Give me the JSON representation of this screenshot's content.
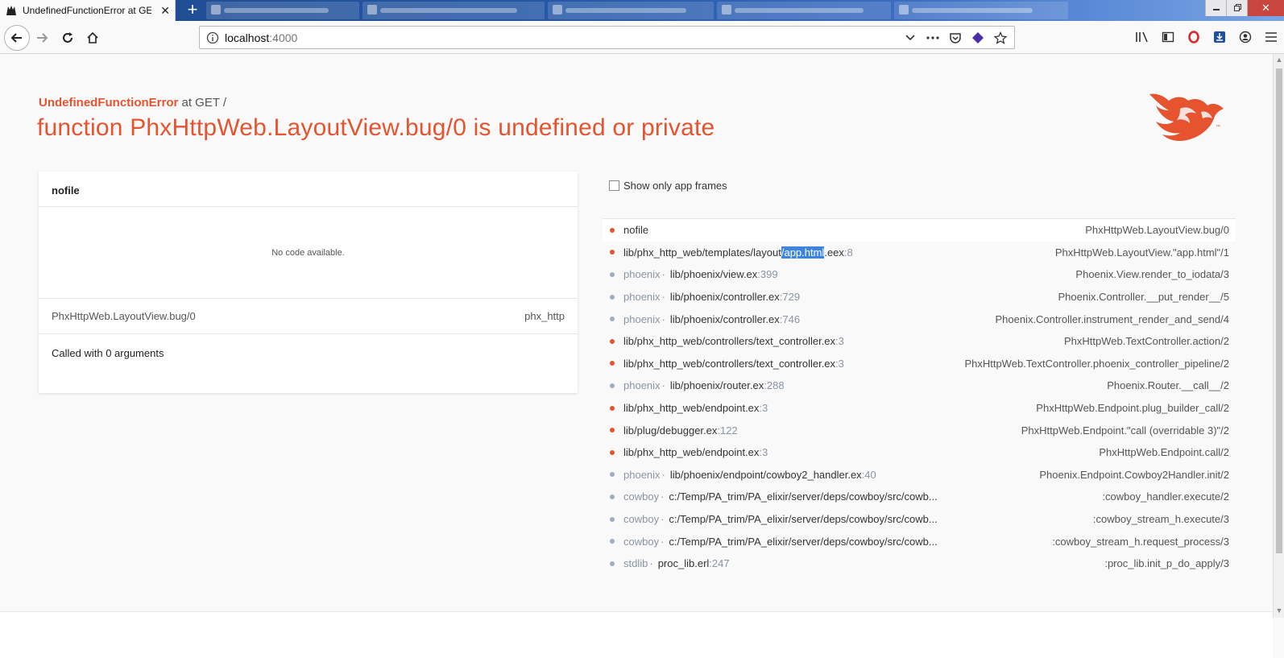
{
  "browser": {
    "tab_title": "UndefinedFunctionError at GET /",
    "url_host": "localhost",
    "url_port": ":4000",
    "new_tab_label": "+",
    "close_tab_label": "✕",
    "window_close_label": "✕"
  },
  "error": {
    "name": "UndefinedFunctionError",
    "at_text": " at GET /",
    "message": "function PhxHttpWeb.LayoutView.bug/0 is undefined or private"
  },
  "code_card": {
    "file": "nofile",
    "no_code_text": "No code available.",
    "function": "PhxHttpWeb.LayoutView.bug/0",
    "app": "phx_http",
    "args_text": "Called with 0 arguments"
  },
  "frames_panel": {
    "toggle_label": "Show only app frames",
    "frames": [
      {
        "app": "",
        "file": "nofile",
        "line": "",
        "info": "PhxHttpWeb.LayoutView.bug/0",
        "kind": "app",
        "active": true
      },
      {
        "app": "",
        "file_pre": "lib/phx_http_web/templates/layout",
        "file_hl": "/app.html",
        "file_post": ".eex",
        "line": ":8",
        "info": "PhxHttpWeb.LayoutView.\"app.html\"/1",
        "kind": "app"
      },
      {
        "app": "phoenix",
        "file": "lib/phoenix/view.ex",
        "line": ":399",
        "info": "Phoenix.View.render_to_iodata/3",
        "kind": "lib"
      },
      {
        "app": "phoenix",
        "file": "lib/phoenix/controller.ex",
        "line": ":729",
        "info": "Phoenix.Controller.__put_render__/5",
        "kind": "lib"
      },
      {
        "app": "phoenix",
        "file": "lib/phoenix/controller.ex",
        "line": ":746",
        "info": "Phoenix.Controller.instrument_render_and_send/4",
        "kind": "lib"
      },
      {
        "app": "",
        "file": "lib/phx_http_web/controllers/text_controller.ex",
        "line": ":3",
        "info": "PhxHttpWeb.TextController.action/2",
        "kind": "app"
      },
      {
        "app": "",
        "file": "lib/phx_http_web/controllers/text_controller.ex",
        "line": ":3",
        "info": "PhxHttpWeb.TextController.phoenix_controller_pipeline/2",
        "kind": "app"
      },
      {
        "app": "phoenix",
        "file": "lib/phoenix/router.ex",
        "line": ":288",
        "info": "Phoenix.Router.__call__/2",
        "kind": "lib"
      },
      {
        "app": "",
        "file": "lib/phx_http_web/endpoint.ex",
        "line": ":3",
        "info": "PhxHttpWeb.Endpoint.plug_builder_call/2",
        "kind": "app"
      },
      {
        "app": "",
        "file": "lib/plug/debugger.ex",
        "line": ":122",
        "info": "PhxHttpWeb.Endpoint.\"call (overridable 3)\"/2",
        "kind": "app"
      },
      {
        "app": "",
        "file": "lib/phx_http_web/endpoint.ex",
        "line": ":3",
        "info": "PhxHttpWeb.Endpoint.call/2",
        "kind": "app"
      },
      {
        "app": "phoenix",
        "file": "lib/phoenix/endpoint/cowboy2_handler.ex",
        "line": ":40",
        "info": "Phoenix.Endpoint.Cowboy2Handler.init/2",
        "kind": "lib"
      },
      {
        "app": "cowboy",
        "file": "c:/Temp/PA_trim/PA_elixir/server/deps/cowboy/src/cowb...",
        "line": "",
        "info": ":cowboy_handler.execute/2",
        "kind": "lib"
      },
      {
        "app": "cowboy",
        "file": "c:/Temp/PA_trim/PA_elixir/server/deps/cowboy/src/cowb...",
        "line": "",
        "info": ":cowboy_stream_h.execute/3",
        "kind": "lib"
      },
      {
        "app": "cowboy",
        "file": "c:/Temp/PA_trim/PA_elixir/server/deps/cowboy/src/cowb...",
        "line": "",
        "info": ":cowboy_stream_h.request_process/3",
        "kind": "lib"
      },
      {
        "app": "stdlib",
        "file": "proc_lib.erl",
        "line": ":247",
        "info": ":proc_lib.init_p_do_apply/3",
        "kind": "lib"
      }
    ]
  },
  "colors": {
    "accent": "#e5542f",
    "lib_bullet": "#a2aebf",
    "selection": "#3b85e0"
  }
}
